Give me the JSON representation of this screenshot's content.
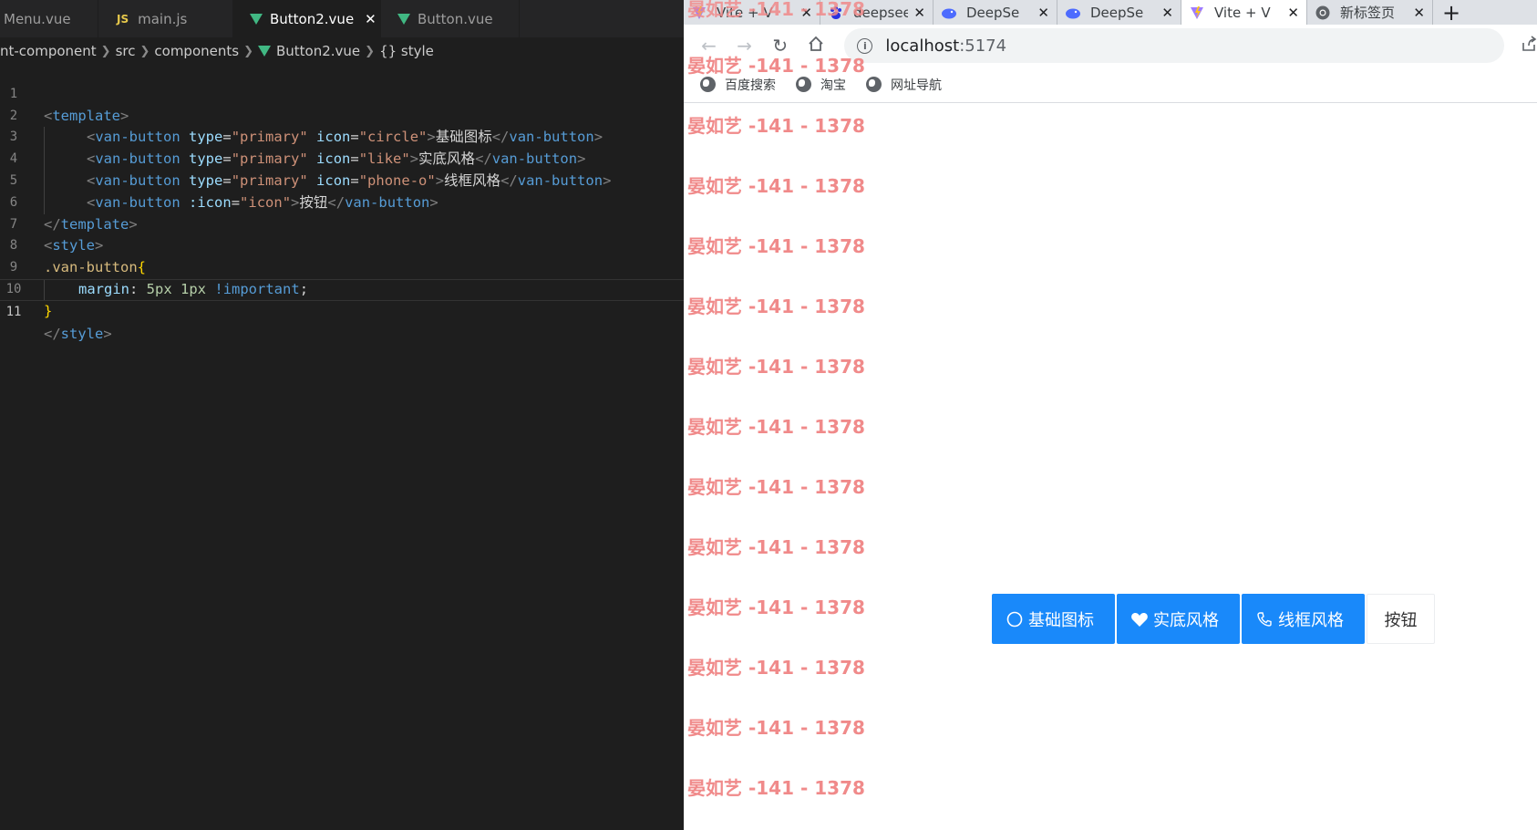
{
  "editor": {
    "tabs": [
      {
        "label": "Menu.vue",
        "icon": "vue-icon",
        "active": false
      },
      {
        "label": "main.js",
        "icon": "js-icon",
        "active": false
      },
      {
        "label": "Button2.vue",
        "icon": "vue-icon",
        "active": true
      },
      {
        "label": "Button.vue",
        "icon": "vue-icon",
        "active": false
      }
    ],
    "js_badge": "JS",
    "breadcrumb": [
      "nt-component",
      "src",
      "components",
      "Button2.vue",
      "{} style"
    ],
    "line_numbers": [
      "1",
      "2",
      "3",
      "4",
      "5",
      "6",
      "7",
      "8",
      "9",
      "10",
      "11"
    ],
    "code": {
      "l1": {
        "tag": "template"
      },
      "l2": {
        "tag": "van-button",
        "a1": "type",
        "v1": "\"primary\"",
        "a2": "icon",
        "v2": "\"circle\"",
        "text": "基础图标"
      },
      "l3": {
        "tag": "van-button",
        "a1": "type",
        "v1": "\"primary\"",
        "a2": "icon",
        "v2": "\"like\"",
        "text": "实底风格"
      },
      "l4": {
        "tag": "van-button",
        "a1": "type",
        "v1": "\"primary\"",
        "a2": "icon",
        "v2": "\"phone-o\"",
        "text": "线框风格"
      },
      "l5": {
        "tag": "van-button",
        "a1": ":icon",
        "v1": "\"icon\"",
        "text": "按钮"
      },
      "l6": {
        "tag": "template"
      },
      "l7": {
        "tag": "style"
      },
      "l8": {
        "selector": ".van-button",
        "brace": "{"
      },
      "l9": {
        "prop": "margin",
        "val1": "5px",
        "val2": "1px",
        "imp": "!important"
      },
      "l10": {
        "brace": "}"
      },
      "l11": {
        "tag": "style"
      }
    }
  },
  "browser": {
    "tabs": [
      {
        "label": "Vite + V",
        "icon": "vite-icon"
      },
      {
        "label": "deepsee",
        "icon": "baidu-icon"
      },
      {
        "label": "DeepSe",
        "icon": "deepseek-icon"
      },
      {
        "label": "DeepSe",
        "icon": "deepseek-icon"
      },
      {
        "label": "Vite + V",
        "icon": "vite-icon",
        "active": true
      },
      {
        "label": "新标签页",
        "icon": "chrome-icon"
      }
    ],
    "close_glyph": "✕",
    "new_tab_glyph": "+",
    "address": {
      "host": "localhost",
      "port": ":5174"
    },
    "bookmarks": [
      "百度搜索",
      "淘宝",
      "网址导航"
    ],
    "watermark": "晏如艺 -141 - 1378",
    "buttons": [
      {
        "label": "基础图标",
        "type": "primary",
        "icon": "circle-icon"
      },
      {
        "label": "实底风格",
        "type": "primary",
        "icon": "heart-icon"
      },
      {
        "label": "线框风格",
        "type": "primary",
        "icon": "phone-icon"
      },
      {
        "label": "按钮",
        "type": "default",
        "icon": ""
      }
    ]
  },
  "colors": {
    "editor_bg": "#1e1e1e",
    "vue_green": "#41b883",
    "vant_primary": "#1989fa",
    "watermark": "#f08a8a"
  }
}
